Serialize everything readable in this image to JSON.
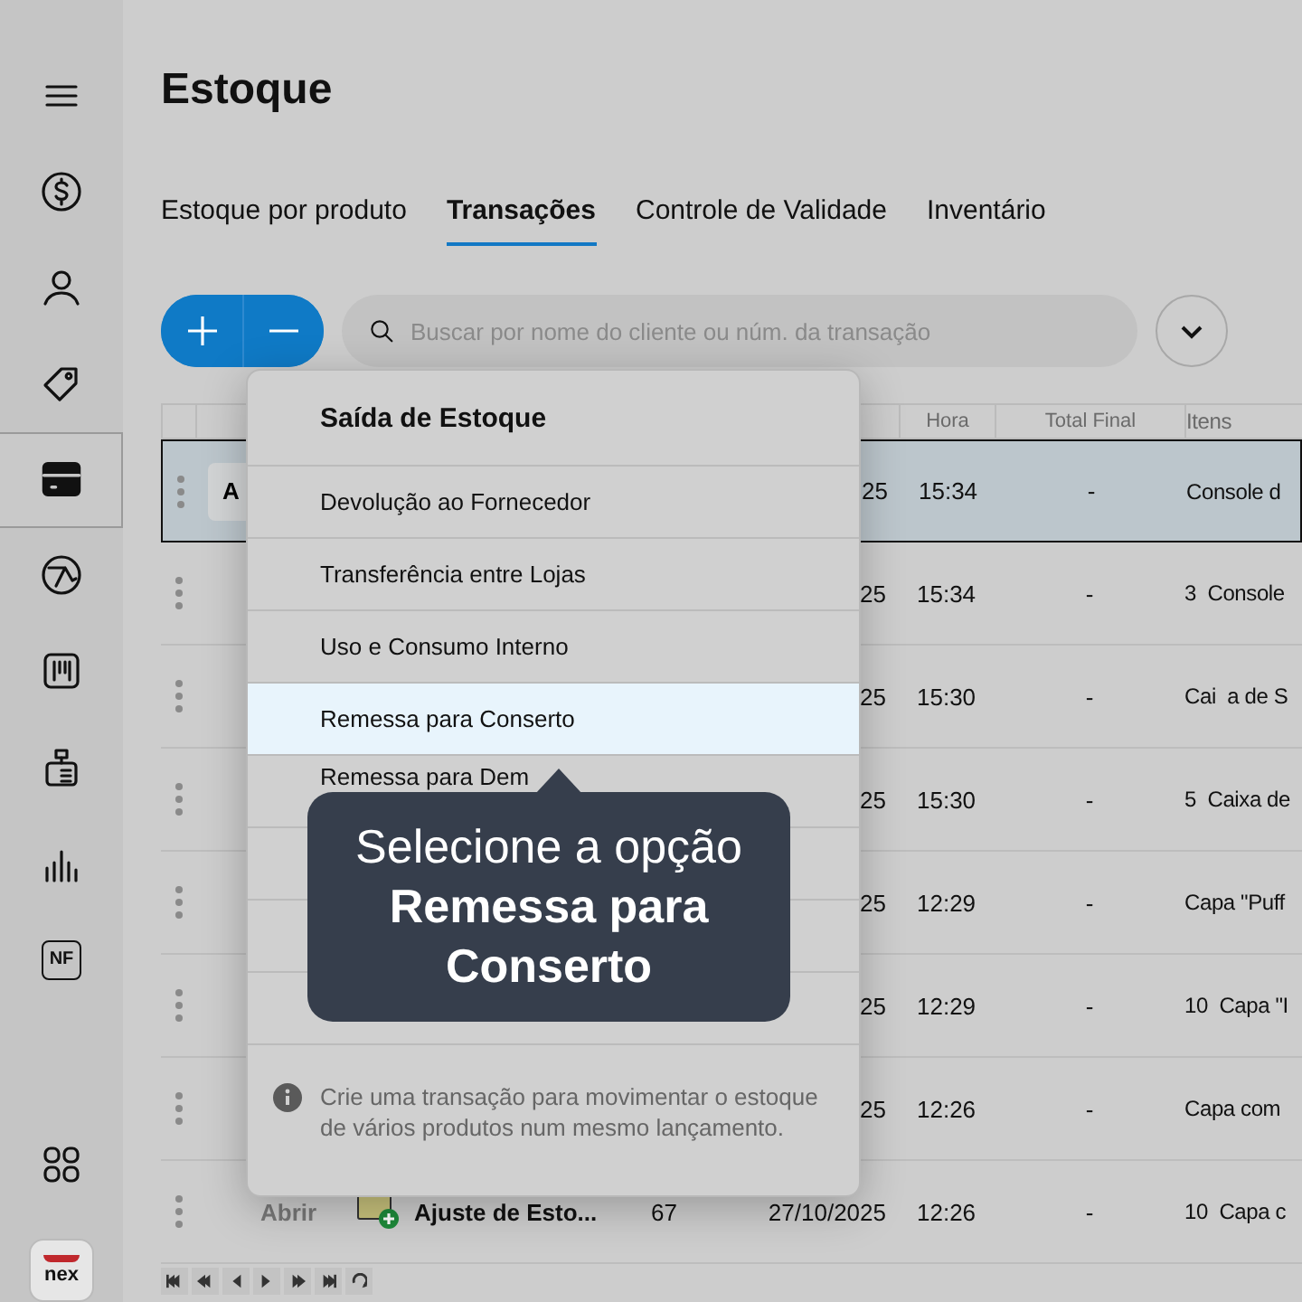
{
  "sidebar": {
    "items": [
      {
        "selected": false
      },
      {
        "selected": false
      },
      {
        "selected": false
      },
      {
        "selected": false
      },
      {
        "selected": true
      },
      {
        "selected": false
      },
      {
        "selected": false
      },
      {
        "selected": false
      },
      {
        "selected": false
      },
      {
        "selected": false,
        "label": "NF"
      },
      {
        "selected": false
      }
    ],
    "logo": "nex"
  },
  "title": "Estoque",
  "tabs": [
    {
      "label": "Estoque por produto",
      "selected": false
    },
    {
      "label": "Transações",
      "selected": true
    },
    {
      "label": "Controle de Validade",
      "selected": false
    },
    {
      "label": "Inventário",
      "selected": false
    }
  ],
  "search": {
    "placeholder": "Buscar por nome do cliente ou núm. da transação"
  },
  "table": {
    "columns": {
      "time": "Hora",
      "total": "Total Final",
      "items": "Itens"
    },
    "rows": [
      {
        "selected": true,
        "open": "A",
        "date": "25",
        "time": "15:34",
        "total": "-",
        "items": "Console d"
      },
      {
        "selected": false,
        "date": "25",
        "time": "15:34",
        "total": "-",
        "items": "3  Console"
      },
      {
        "selected": false,
        "date": "25",
        "time": "15:30",
        "total": "-",
        "items": "Cai  a de S"
      },
      {
        "selected": false,
        "date": "25",
        "time": "15:30",
        "total": "-",
        "items": "5  Caixa de"
      },
      {
        "selected": false,
        "date": "25",
        "time": "12:29",
        "total": "-",
        "items": "Capa \"Puff"
      },
      {
        "selected": false,
        "date": "25",
        "time": "12:29",
        "total": "-",
        "items": "10  Capa \"I"
      },
      {
        "selected": false,
        "date": "25",
        "time": "12:26",
        "total": "-",
        "items": "Capa com"
      },
      {
        "selected": false,
        "open": "Abrir",
        "type": "Ajuste de Esto...",
        "number": "67",
        "date": "27/10/2025",
        "time": "12:26",
        "total": "-",
        "items": "10  Capa c"
      }
    ]
  },
  "menu": {
    "title": "Saída de Estoque",
    "items": [
      {
        "label": "Devolução ao Fornecedor",
        "selected": false
      },
      {
        "label": "Transferência entre Lojas",
        "selected": false
      },
      {
        "label": "Uso e Consumo Interno",
        "selected": false
      },
      {
        "label": "Remessa para Conserto",
        "selected": true
      },
      {
        "label": "Remessa para Dem",
        "selected": false
      }
    ],
    "info": "Crie uma transação para movimentar o estoque de vários produtos num mesmo lançamento."
  },
  "tooltip": "Selecione a opção **Remessa para Conserto**"
}
